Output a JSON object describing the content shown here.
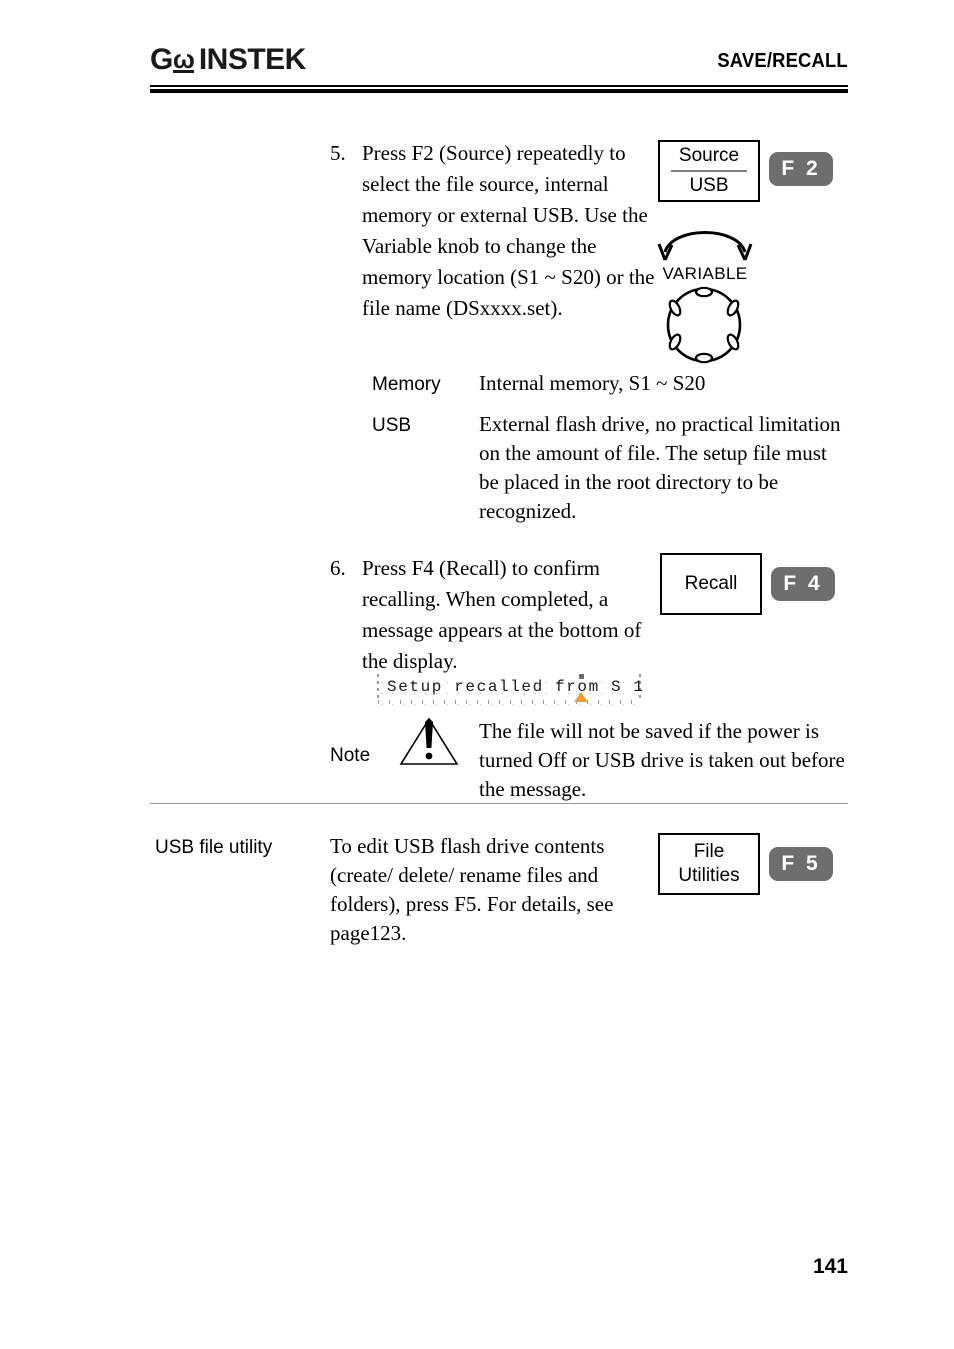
{
  "header": {
    "logo_gw": "G",
    "logo_w": "ω",
    "logo_instek": "INSTEK",
    "chapter_title": "SAVE/RECALL"
  },
  "steps": [
    {
      "number": "5.",
      "text": "Press F2 (Source) repeatedly to select the file source, internal memory or external USB. Use the Variable knob to change the memory location (S1 ~ S20) or the file name (DSxxxx.set)."
    },
    {
      "number": "6.",
      "text": "Press F4 (Recall) to confirm recalling. When completed, a message appears at the bottom of the display."
    }
  ],
  "panel_keys": {
    "source": {
      "line1": "Source",
      "line2": "USB",
      "has_divider": true,
      "fkey": "F 2"
    },
    "recall": {
      "line1": "Recall",
      "line2": "",
      "has_divider": false,
      "fkey": "F 4"
    },
    "file_utilities": {
      "line1": "File",
      "line2": "Utilities",
      "has_divider": false,
      "fkey": "F 5"
    }
  },
  "variable_knob": {
    "label": "VARIABLE",
    "icon": "rotary-knob-icon",
    "arrow_icon": "bidirectional-rotate-arrow-icon"
  },
  "definitions": [
    {
      "term": "Memory",
      "description": "Internal memory, S1 ~ S20"
    },
    {
      "term": "USB",
      "description": "External flash drive, no practical limitation on the amount of file. The setup file must be placed in the root directory to be recognized."
    }
  ],
  "scope_message": {
    "text": "Setup recalled from S 1",
    "marker_color": "#f0a030",
    "grid_color": "#b8b8b8"
  },
  "note": {
    "label": "Note",
    "icon": "warning-triangle-icon",
    "text": "The file will not be saved if the power is turned Off or USB drive is taken out before the message."
  },
  "usb_file_utility": {
    "label": "USB file utility",
    "text": "To edit USB flash drive contents (create/ delete/ rename files and folders), press F5. For details, see page123."
  },
  "footer": {
    "page_number": "141"
  },
  "colors": {
    "fkey_background": "#6e6e6e",
    "fkey_text": "#ffffff",
    "divider_gray": "#808080",
    "rule_gray": "#9a9a9a",
    "ink": "#000000"
  }
}
